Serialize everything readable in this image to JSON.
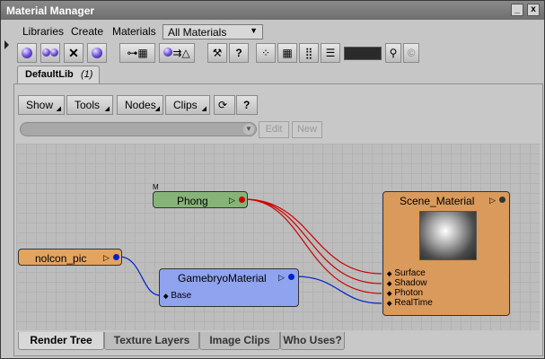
{
  "window": {
    "title": "Material Manager"
  },
  "menu": {
    "items": [
      "Libraries",
      "Create",
      "Materials"
    ],
    "materials_filter": "All Materials"
  },
  "toolbar": {
    "icons": [
      "new-material-icon",
      "merge-icon",
      "delete-icon",
      "add-icon",
      "connect-icon",
      "node-flow-icon",
      "render-icon",
      "eyedropper-icon",
      "help-icon",
      "view-small-icon",
      "view-grid-icon",
      "view-dense-icon",
      "view-list-icon",
      "search-icon",
      "clear-icon"
    ],
    "help_glyph": "?"
  },
  "library_tab": {
    "name": "DefaultLib",
    "count": "(1)"
  },
  "render_tree_toolbar": {
    "buttons": [
      "Show",
      "Tools",
      "Nodes",
      "Clips"
    ],
    "help_glyph": "?"
  },
  "path_bar": {
    "edit_label": "Edit",
    "new_label": "New"
  },
  "graph": {
    "nodes": {
      "phong": {
        "title": "Phong",
        "marker": "M",
        "color": "#86b478"
      },
      "nolcon": {
        "title": "nolcon_pic",
        "color": "#e3a460"
      },
      "gamebryo": {
        "title": "GamebryoMaterial",
        "color": "#8fa3ee",
        "ports": [
          "Base"
        ]
      },
      "scene": {
        "title": "Scene_Material",
        "color": "#d99a5c",
        "ports": [
          "Surface",
          "Shadow",
          "Photon",
          "RealTime"
        ]
      }
    },
    "wire_colors": {
      "red": "#cc0000",
      "blue": "#0022cc"
    }
  },
  "bottom_tabs": [
    "Render Tree",
    "Texture Layers",
    "Image Clips",
    "Who Uses?"
  ],
  "active_tab": "Render Tree"
}
